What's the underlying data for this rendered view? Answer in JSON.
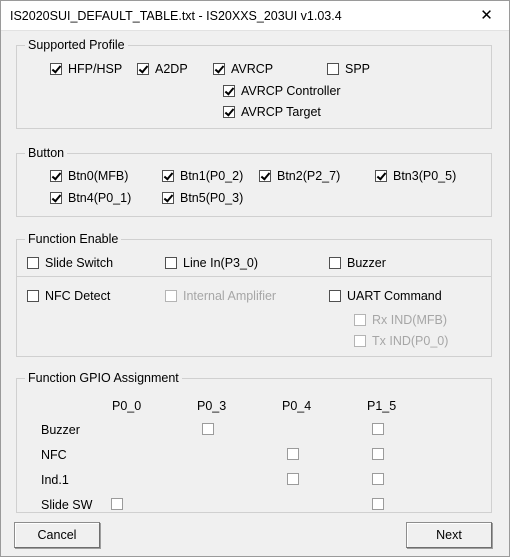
{
  "window": {
    "title": "IS2020SUI_DEFAULT_TABLE.txt - IS20XXS_203UI v1.03.4",
    "close_icon": "close-icon",
    "close_glyph": "✕"
  },
  "supported_profile": {
    "legend": "Supported Profile",
    "items": [
      {
        "label": "HFP/HSP",
        "checked": true,
        "disabled": false
      },
      {
        "label": "A2DP",
        "checked": true,
        "disabled": false
      },
      {
        "label": "AVRCP",
        "checked": true,
        "disabled": false
      },
      {
        "label": "SPP",
        "checked": false,
        "disabled": false
      },
      {
        "label": "AVRCP Controller",
        "checked": true,
        "disabled": false
      },
      {
        "label": "AVRCP Target",
        "checked": true,
        "disabled": false
      }
    ]
  },
  "button_group": {
    "legend": "Button",
    "items": [
      {
        "label": "Btn0(MFB)",
        "checked": true,
        "disabled": false
      },
      {
        "label": "Btn1(P0_2)",
        "checked": true,
        "disabled": false
      },
      {
        "label": "Btn2(P2_7)",
        "checked": true,
        "disabled": false
      },
      {
        "label": "Btn3(P0_5)",
        "checked": true,
        "disabled": false
      },
      {
        "label": "Btn4(P0_1)",
        "checked": true,
        "disabled": false
      },
      {
        "label": "Btn5(P0_3)",
        "checked": true,
        "disabled": false
      }
    ]
  },
  "function_enable": {
    "legend": "Function Enable",
    "items": [
      {
        "label": "Slide Switch",
        "checked": false,
        "disabled": false
      },
      {
        "label": "Line In(P3_0)",
        "checked": false,
        "disabled": false
      },
      {
        "label": "Buzzer",
        "checked": false,
        "disabled": false
      },
      {
        "label": "NFC Detect",
        "checked": false,
        "disabled": false
      },
      {
        "label": "Internal Amplifier",
        "checked": false,
        "disabled": true
      },
      {
        "label": "UART Command",
        "checked": false,
        "disabled": false
      },
      {
        "label": "Rx IND(MFB)",
        "checked": false,
        "disabled": true
      },
      {
        "label": "Tx IND(P0_0)",
        "checked": false,
        "disabled": true
      }
    ]
  },
  "gpio_assignment": {
    "legend": "Function GPIO Assignment",
    "columns": [
      "P0_0",
      "P0_3",
      "P0_4",
      "P1_5"
    ],
    "rows": [
      {
        "label": "Buzzer",
        "cells": [
          null,
          false,
          null,
          false
        ]
      },
      {
        "label": "NFC",
        "cells": [
          null,
          null,
          false,
          false
        ]
      },
      {
        "label": "Ind.1",
        "cells": [
          null,
          null,
          false,
          false
        ]
      },
      {
        "label": "Slide SW",
        "cells": [
          false,
          null,
          null,
          false
        ]
      }
    ]
  },
  "footer": {
    "cancel_label": "Cancel",
    "next_label": "Next"
  }
}
